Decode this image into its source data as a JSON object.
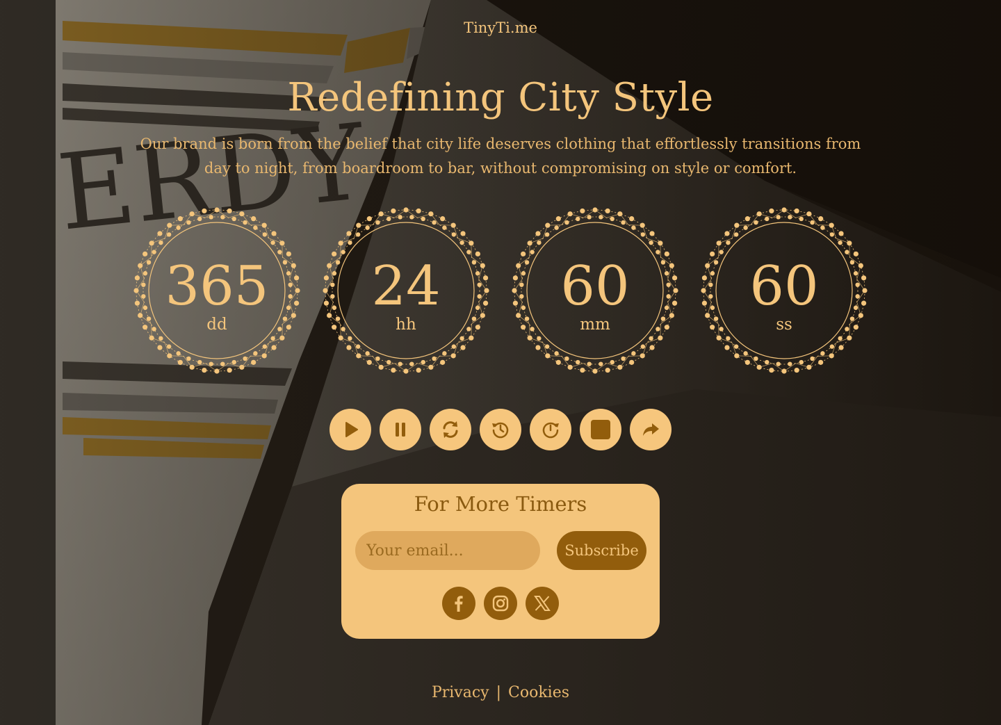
{
  "brand": "TinyTi.me",
  "hero": {
    "title": "Redefining City Style",
    "subtitle": "Our brand is born from the belief that city life deserves clothing that effortlessly transitions from day to night, from boardroom to bar, without compromising on style or comfort."
  },
  "timers": [
    {
      "value": "365",
      "unit": "dd"
    },
    {
      "value": "24",
      "unit": "hh"
    },
    {
      "value": "60",
      "unit": "mm"
    },
    {
      "value": "60",
      "unit": "ss"
    }
  ],
  "controls": [
    {
      "name": "play-button",
      "icon": "play-icon"
    },
    {
      "name": "pause-button",
      "icon": "pause-icon"
    },
    {
      "name": "reset-button",
      "icon": "refresh-icon"
    },
    {
      "name": "history-button",
      "icon": "history-icon"
    },
    {
      "name": "restart-button",
      "icon": "clock-forward-icon"
    },
    {
      "name": "stop-button",
      "icon": "stop-icon"
    },
    {
      "name": "share-button",
      "icon": "share-icon"
    }
  ],
  "subscribe": {
    "title": "For More Timers",
    "email_placeholder": "Your email...",
    "button_label": "Subscribe"
  },
  "socials": [
    "facebook-icon",
    "instagram-icon",
    "x-icon"
  ],
  "footer": {
    "privacy": "Privacy",
    "separator": "|",
    "cookies": "Cookies"
  },
  "colors": {
    "accent": "#f4c57c",
    "dark_accent": "#925d0c",
    "card": "#f4c57c"
  }
}
